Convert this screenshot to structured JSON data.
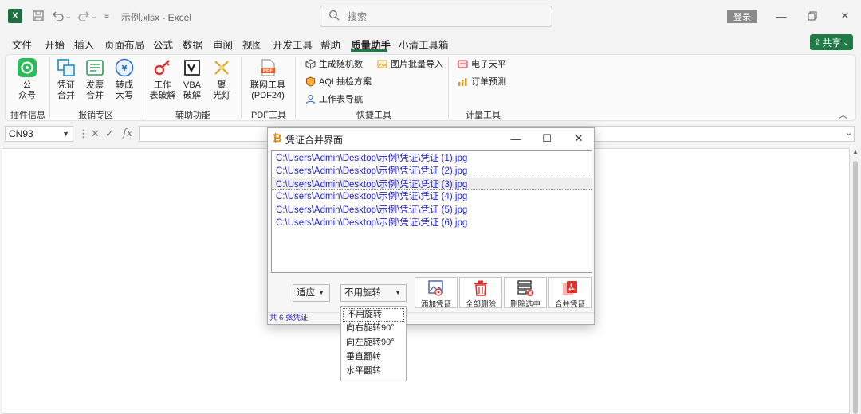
{
  "titlebar": {
    "app_logo": "X",
    "doc_title": "示例.xlsx  -  Excel",
    "search_placeholder": "搜索",
    "login_label": "登录"
  },
  "menu": {
    "items": [
      "文件",
      "开始",
      "插入",
      "页面布局",
      "公式",
      "数据",
      "审阅",
      "视图",
      "开发工具",
      "帮助",
      "质量助手",
      "小清工具箱"
    ],
    "active": "质量助手",
    "share_label": "共享"
  },
  "ribbon": {
    "buttons": [
      {
        "label1": "公",
        "label2": "众号",
        "icon": "wechat-icon"
      },
      {
        "label1": "凭证",
        "label2": "合并",
        "icon": "voucher-merge-icon"
      },
      {
        "label1": "发票",
        "label2": "合并",
        "icon": "invoice-merge-icon"
      },
      {
        "label1": "转成",
        "label2": "大写",
        "icon": "uppercase-icon"
      },
      {
        "label1": "工作",
        "label2": "表破解",
        "icon": "key-icon"
      },
      {
        "label1": "VBA",
        "label2": "破解",
        "icon": "vba-icon"
      },
      {
        "label1": "聚",
        "label2": "光灯",
        "icon": "spotlight-icon"
      },
      {
        "label1": "联网工具",
        "label2": "(PDF24)",
        "icon": "pdf-icon"
      }
    ],
    "small_buttons": [
      "生成随机数",
      "AQL抽检方案",
      "工作表导航",
      "图片批量导入",
      "电子天平",
      "订单预测"
    ],
    "groups": [
      "插件信息",
      "报销专区",
      "辅助功能",
      "PDF工具",
      "快捷工具",
      "计量工具"
    ]
  },
  "formula_bar": {
    "name_box": "CN93",
    "symbols": [
      "⋮",
      "✕",
      "✓",
      "fx"
    ]
  },
  "dialog": {
    "title": "凭证合并界面",
    "files": [
      "C:\\Users\\Admin\\Desktop\\示例\\凭证\\凭证 (1).jpg",
      "C:\\Users\\Admin\\Desktop\\示例\\凭证\\凭证 (2).jpg",
      "C:\\Users\\Admin\\Desktop\\示例\\凭证\\凭证 (3).jpg",
      "C:\\Users\\Admin\\Desktop\\示例\\凭证\\凭证 (4).jpg",
      "C:\\Users\\Admin\\Desktop\\示例\\凭证\\凭证 (5).jpg",
      "C:\\Users\\Admin\\Desktop\\示例\\凭证\\凭证 (6).jpg"
    ],
    "selected_index": 2,
    "fit_select": "适应",
    "rotate_select": "不用旋转",
    "buttons": [
      "添加凭证",
      "全部删除",
      "删除选中",
      "合并凭证"
    ],
    "status": "共 6 张凭证"
  },
  "rotate_options": [
    "不用旋转",
    "向右旋转90°",
    "向左旋转90°",
    "垂直翻转",
    "水平翻转"
  ],
  "colors": {
    "excel_green": "#1f7a45",
    "file_text": "#2222cc",
    "accent_red": "#d9302c"
  }
}
